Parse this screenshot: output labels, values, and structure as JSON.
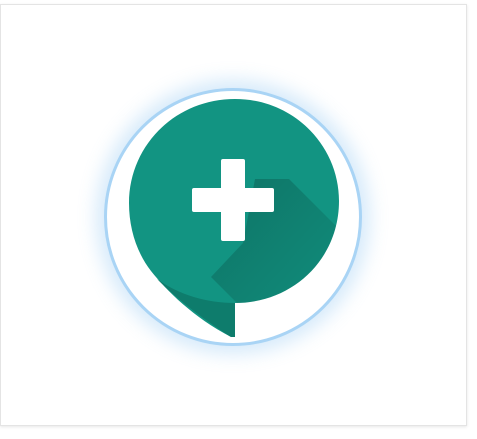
{
  "app_icon": {
    "icon": "speech-bubble-plus-icon",
    "bubble_color": "#129482",
    "bubble_tail_shade": "#0e7c6c",
    "plus_color": "#ffffff",
    "ring_color": "#a9d4f5",
    "glow_color": "#78b9f0"
  }
}
